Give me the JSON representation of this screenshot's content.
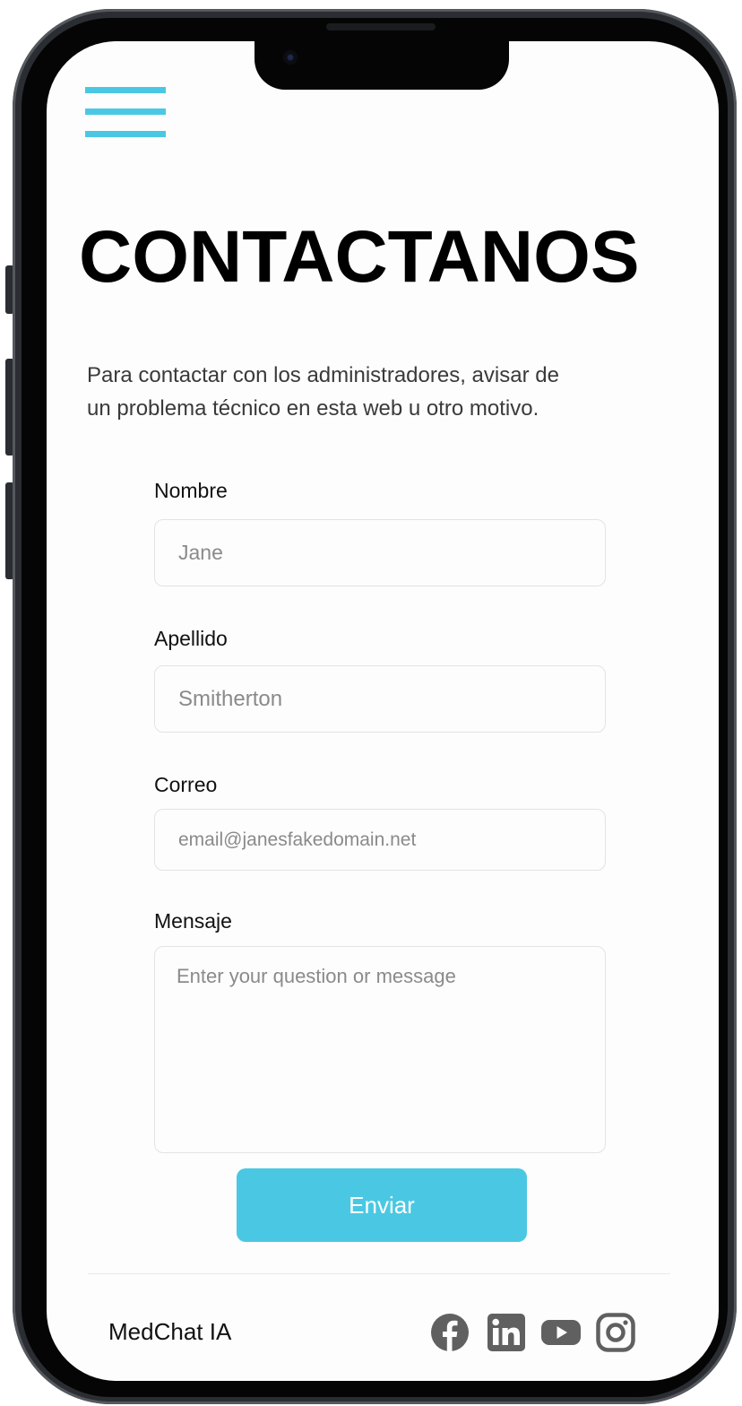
{
  "header": {
    "menu_icon": "hamburger-menu-icon"
  },
  "page": {
    "title": "CONTACTANOS",
    "intro_line1": "Para contactar con los administradores, avisar de",
    "intro_line2": "un problema técnico en esta web u otro motivo."
  },
  "form": {
    "nombre": {
      "label": "Nombre",
      "placeholder": "Jane"
    },
    "apellido": {
      "label": "Apellido",
      "placeholder": "Smitherton"
    },
    "correo": {
      "label": "Correo",
      "placeholder": "email@janesfakedomain.net"
    },
    "mensaje": {
      "label": "Mensaje",
      "placeholder": "Enter your question or message"
    },
    "submit_label": "Enviar"
  },
  "footer": {
    "brand": "MedChat IA",
    "social": [
      "facebook-icon",
      "linkedin-icon",
      "youtube-icon",
      "instagram-icon"
    ]
  },
  "colors": {
    "accent": "#4ac8e3",
    "text": "#111111",
    "muted": "#8a8a8a"
  }
}
